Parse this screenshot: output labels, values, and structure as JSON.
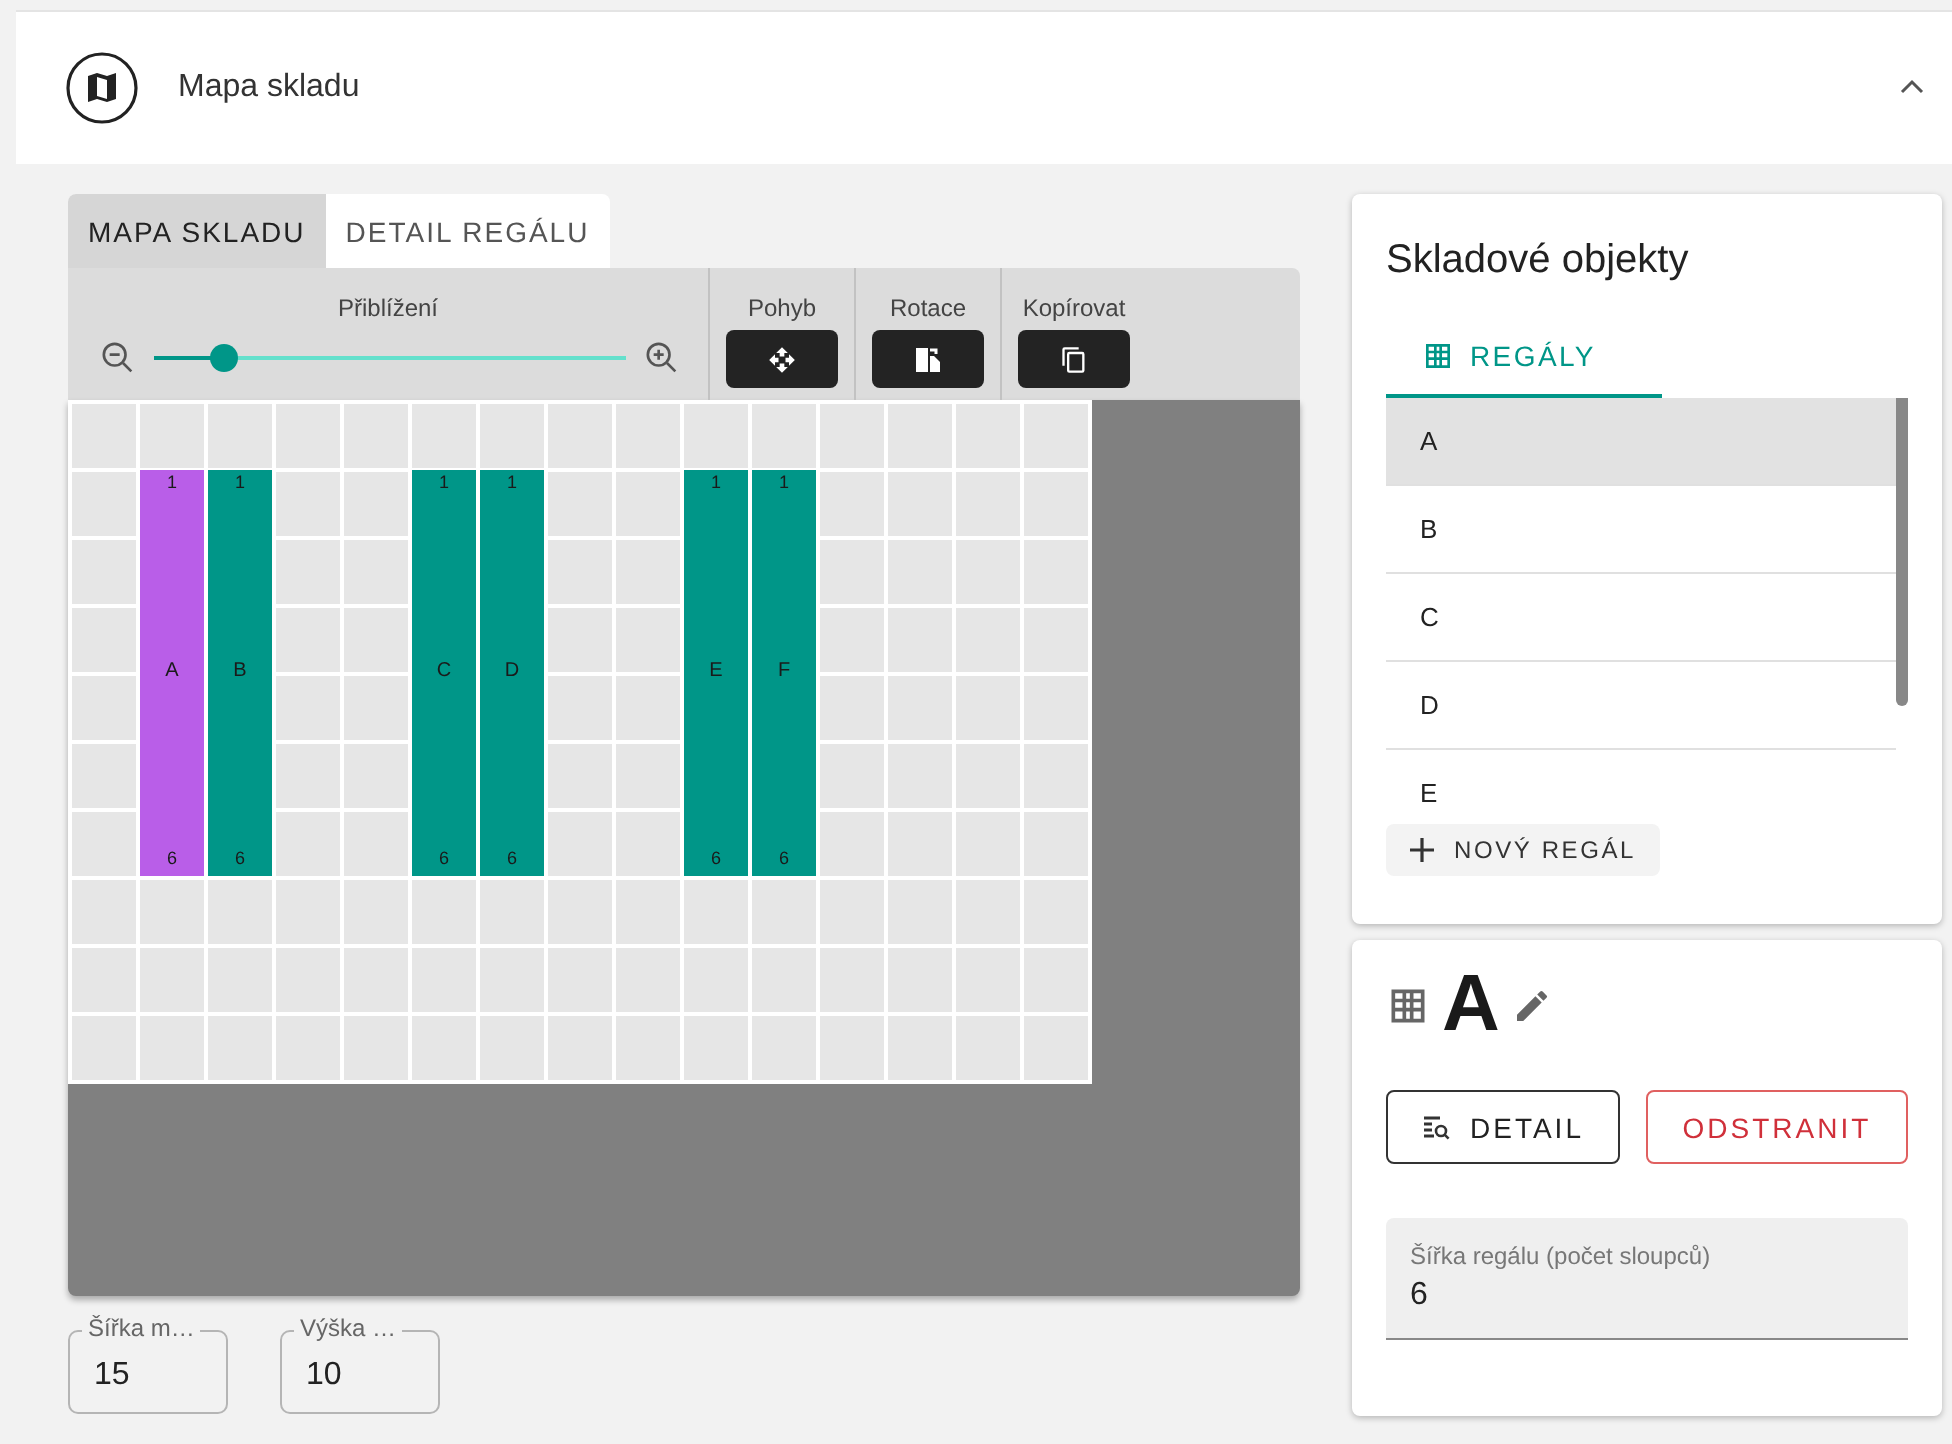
{
  "header": {
    "title": "Mapa skladu",
    "expanded": true
  },
  "view_tabs": [
    {
      "label": "MAPA SKLADU",
      "selected": true
    },
    {
      "label": "DETAIL REGÁLU",
      "selected": false
    }
  ],
  "toolbar": {
    "zoom": {
      "label": "Přiblížení",
      "level": 0.15
    },
    "tools": [
      {
        "label": "Pohyb",
        "kind": "move"
      },
      {
        "label": "Rotace",
        "kind": "rotate"
      },
      {
        "label": "Kopírovat",
        "kind": "copy"
      }
    ]
  },
  "map": {
    "racks": [
      {
        "name": "A",
        "first": "1",
        "last": "6",
        "selected": true
      },
      {
        "name": "B",
        "first": "1",
        "last": "6",
        "selected": false
      },
      {
        "name": "C",
        "first": "1",
        "last": "6",
        "selected": false
      },
      {
        "name": "D",
        "first": "1",
        "last": "6",
        "selected": false
      },
      {
        "name": "E",
        "first": "1",
        "last": "6",
        "selected": false
      },
      {
        "name": "F",
        "first": "1",
        "last": "6",
        "selected": false
      }
    ]
  },
  "map_size": [
    {
      "label": "Šířka m…",
      "value": "15"
    },
    {
      "label": "Výška …",
      "value": "10"
    }
  ],
  "objects": {
    "title": "Skladové objekty",
    "tab": "REGÁLY",
    "items": [
      {
        "name": "A",
        "selected": true
      },
      {
        "name": "B",
        "selected": false
      },
      {
        "name": "C",
        "selected": false
      },
      {
        "name": "D",
        "selected": false
      },
      {
        "name": "E",
        "selected": false
      }
    ],
    "add_button": "NOVÝ REGÁL"
  },
  "detail": {
    "name": "A",
    "detail_button": "DETAIL",
    "delete_button": "ODSTRANIT",
    "field": {
      "label": "Šířka regálu (počet sloupců)",
      "value": "6"
    }
  }
}
